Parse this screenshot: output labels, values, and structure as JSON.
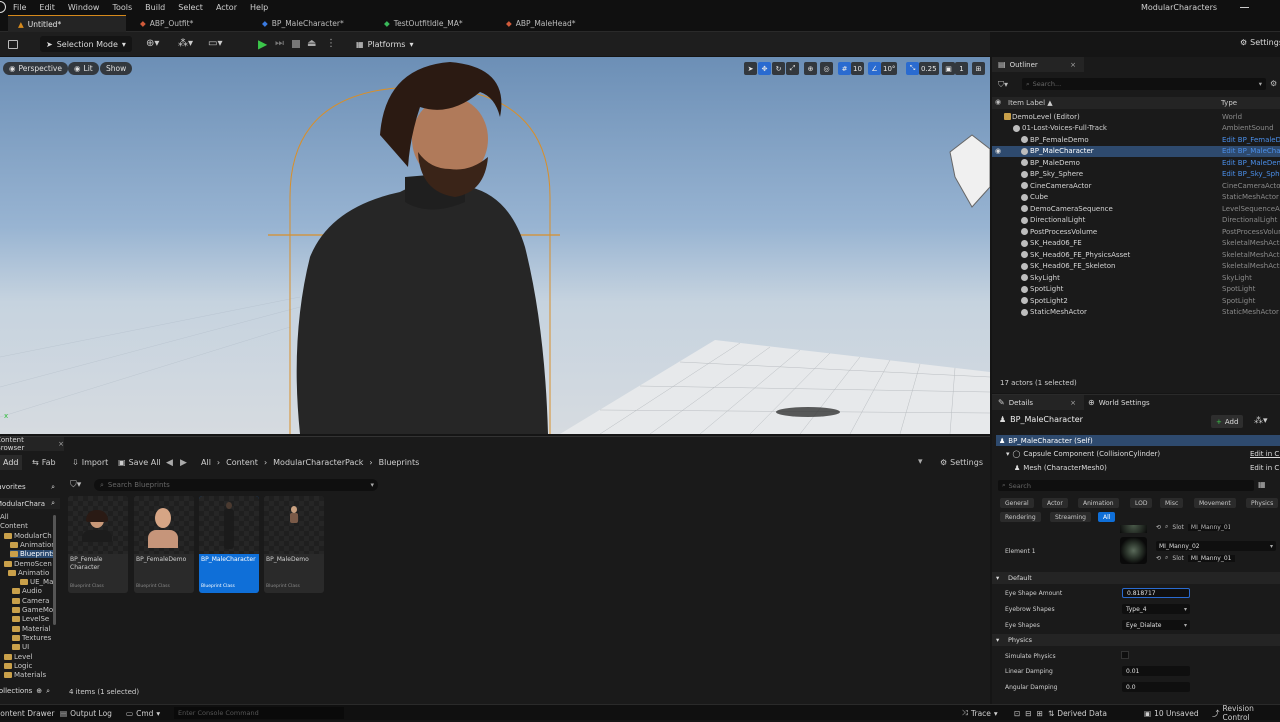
{
  "menu": {
    "items": [
      "File",
      "Edit",
      "Window",
      "Tools",
      "Build",
      "Select",
      "Actor",
      "Help"
    ],
    "project_name": "ModularCharacters"
  },
  "tabs": [
    {
      "label": "Untitled*"
    },
    {
      "label": "ABP_Outfit*"
    },
    {
      "label": "BP_MaleCharacter*"
    },
    {
      "label": "TestOutfitIdle_MA*"
    },
    {
      "label": "ABP_MaleHead*"
    }
  ],
  "toolbar": {
    "selection_mode": "Selection Mode",
    "platforms": "Platforms",
    "settings": "Settings"
  },
  "viewport": {
    "perspective": "Perspective",
    "lit": "Lit",
    "show": "Show",
    "grid_size": "10",
    "rotation_snap": "10°",
    "scale_snap": "0.25",
    "camera_speed": "1"
  },
  "content_browser": {
    "title": "Content Browser",
    "add": "Add",
    "fab": "Fab",
    "import": "Import",
    "save_all": "Save All",
    "settings": "Settings",
    "breadcrumb": [
      "All",
      "Content",
      "ModularCharacterPack",
      "Blueprints"
    ],
    "search_placeholder": "Search Blueprints",
    "favorites": "Favorites",
    "root": "ModularChara",
    "tree": [
      "All",
      "Content",
      "ModularCh",
      "Animation",
      "Blueprints",
      "DemoScen",
      "Animatio",
      "UE_Ma",
      "Audio",
      "Camera",
      "GameMo",
      "LevelSe",
      "Material",
      "Textures",
      "UI",
      "Level",
      "Logic",
      "Materials"
    ],
    "collections": "Collections",
    "assets": [
      {
        "name": "BP_Female Character",
        "class": "Blueprint Class"
      },
      {
        "name": "BP_FemaleDemo",
        "class": "Blueprint Class"
      },
      {
        "name": "BP_MaleCharacter",
        "class": "Blueprint Class"
      },
      {
        "name": "BP_MaleDemo",
        "class": "Blueprint Class"
      }
    ],
    "item_count": "4 items (1 selected)"
  },
  "outliner": {
    "title": "Outliner",
    "search_placeholder": "Search...",
    "col_label": "Item Label ▲",
    "col_type": "Type",
    "rows": [
      {
        "label": "DemoLevel (Editor)",
        "type": "World",
        "link": false
      },
      {
        "label": "01-Lost-Voices-Full-Track",
        "type": "AmbientSound",
        "link": false
      },
      {
        "label": "BP_FemaleDemo",
        "type": "Edit BP_FemaleDemo",
        "link": true
      },
      {
        "label": "BP_MaleCharacter",
        "type": "Edit BP_MaleCharacter",
        "link": true
      },
      {
        "label": "BP_MaleDemo",
        "type": "Edit BP_MaleDemo",
        "link": true
      },
      {
        "label": "BP_Sky_Sphere",
        "type": "Edit BP_Sky_Sphere",
        "link": true
      },
      {
        "label": "CineCameraActor",
        "type": "CineCameraActor",
        "link": false
      },
      {
        "label": "Cube",
        "type": "StaticMeshActor",
        "link": false
      },
      {
        "label": "DemoCameraSequence",
        "type": "LevelSequenceActor",
        "link": false
      },
      {
        "label": "DirectionalLight",
        "type": "DirectionalLight",
        "link": false
      },
      {
        "label": "PostProcessVolume",
        "type": "PostProcessVolume",
        "link": false
      },
      {
        "label": "SK_Head06_FE",
        "type": "SkeletalMeshActor",
        "link": false
      },
      {
        "label": "SK_Head06_FE_PhysicsAsset",
        "type": "SkeletalMeshActor",
        "link": false
      },
      {
        "label": "SK_Head06_FE_Skeleton",
        "type": "SkeletalMeshActor",
        "link": false
      },
      {
        "label": "SkyLight",
        "type": "SkyLight",
        "link": false
      },
      {
        "label": "SpotLight",
        "type": "SpotLight",
        "link": false
      },
      {
        "label": "SpotLight2",
        "type": "SpotLight",
        "link": false
      },
      {
        "label": "StaticMeshActor",
        "type": "StaticMeshActor",
        "link": false
      }
    ],
    "actor_count": "17 actors (1 selected)"
  },
  "details": {
    "tab_details": "Details",
    "tab_world_settings": "World Settings",
    "actor_name": "BP_MaleCharacter",
    "add": "Add",
    "self": "BP_MaleCharacter (Self)",
    "capsule": "Capsule Component (CollisionCylinder)",
    "capsule_edit": "Edit in C++",
    "mesh": "Mesh (CharacterMesh0)",
    "mesh_edit": "Edit in C++",
    "search_placeholder": "Search",
    "filter_tabs": [
      "General",
      "Actor",
      "Animation",
      "LOD",
      "Misc",
      "Movement",
      "Physics",
      "Rendering",
      "Streaming",
      "All"
    ],
    "element_label": "Element 1",
    "element_mat": "MI_Manny_02",
    "slot_label": "Slot",
    "slot_value": "MI_Manny_01",
    "slot_value_top": "MI_Manny_01",
    "default_section": "Default",
    "eye_shape_amount_label": "Eye Shape Amount",
    "eye_shape_amount": "0.818717",
    "eyebrow_shapes_label": "Eyebrow Shapes",
    "eyebrow_shapes": "Type_4",
    "eye_shapes_label": "Eye Shapes",
    "eye_shapes": "Eye_Dialate",
    "physics_section": "Physics",
    "simulate_physics_label": "Simulate Physics",
    "linear_damping_label": "Linear Damping",
    "linear_damping": "0.01",
    "angular_damping_label": "Angular Damping",
    "angular_damping": "0.0"
  },
  "status": {
    "content_drawer": "Content Drawer",
    "output_log": "Output Log",
    "cmd": "Cmd",
    "console_placeholder": "Enter Console Command",
    "trace": "Trace",
    "derived_data": "Derived Data",
    "unsaved": "10 Unsaved",
    "revision_control": "Revision Control"
  }
}
